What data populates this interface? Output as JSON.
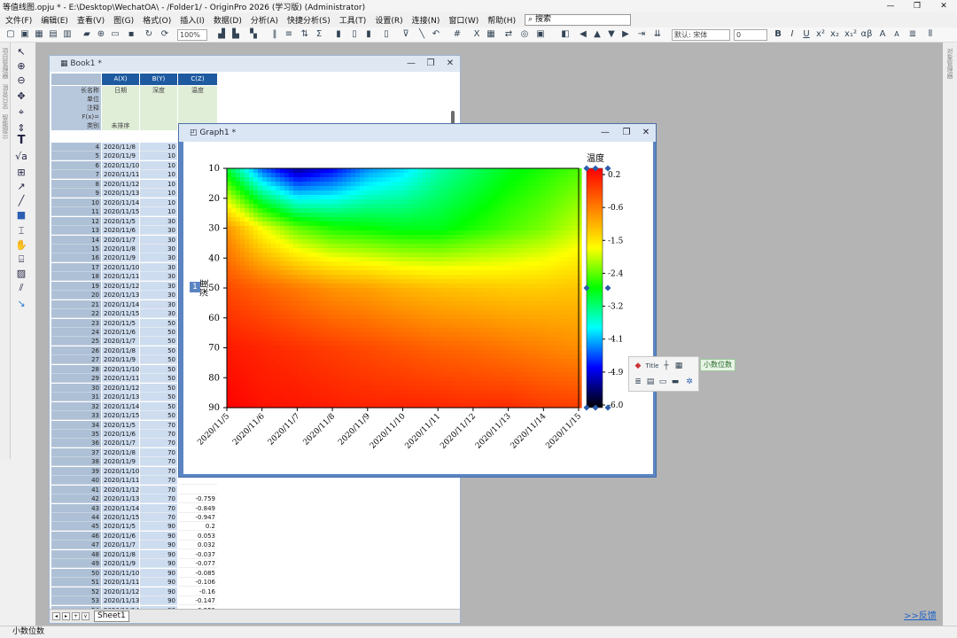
{
  "app": {
    "title": "等值线图.opju * - E:\\Desktop\\WechatOA\\ - /Folder1/ - OriginPro 2026 (学习版) (Administrator)",
    "window_controls": [
      "—",
      "❐",
      "✕"
    ]
  },
  "menu": {
    "items": [
      "文件(F)",
      "编辑(E)",
      "查看(V)",
      "图(G)",
      "格式(O)",
      "插入(I)",
      "数据(D)",
      "分析(A)",
      "快捷分析(S)",
      "工具(T)",
      "设置(R)",
      "连接(N)",
      "窗口(W)",
      "帮助(H)"
    ],
    "search_placeholder": "搜索"
  },
  "toolbar": {
    "zoom": "100%",
    "font_name": "默认: 宋体",
    "font_size": "0",
    "format_buttons": [
      "B",
      "I",
      "U",
      "x²",
      "x₂",
      "x₁²",
      "αβ",
      "A",
      "A"
    ],
    "icons": [
      "new-project-icon",
      "open-icon",
      "save-icon",
      "graph-icon",
      "arrow-left-icon",
      "arrow-up-icon",
      "arrow-down-icon",
      "arrow-right-icon"
    ]
  },
  "left_tools": {
    "icons": [
      "pointer-icon",
      "zoom-in-icon",
      "zoom-out-icon",
      "pan-icon",
      "crosshair-icon",
      "scale-icon",
      "text-icon",
      "equation-icon",
      "box-icon",
      "arrow-icon",
      "line-icon",
      "rectangle-icon",
      "marker-icon",
      "hand-icon",
      "data-reader-icon",
      "region-icon",
      "curve-icon",
      "fit-icon"
    ],
    "text_tool": "T",
    "sqrt_tool": "√a"
  },
  "rails": {
    "left_labels": [
      "项目管理器",
      "消息日志",
      "智能提示"
    ],
    "right_labels": [
      "对象管理器"
    ]
  },
  "book": {
    "title": "Book1 *",
    "columns": [
      "A(X)",
      "B(Y)",
      "C(Z)"
    ],
    "label_rows": [
      {
        "name": "长名称",
        "a": "日期",
        "b": "深度",
        "c": "温度"
      },
      {
        "name": "单位",
        "a": "",
        "b": "",
        "c": ""
      },
      {
        "name": "注释",
        "a": "",
        "b": "",
        "c": ""
      },
      {
        "name": "F(x)=",
        "a": "",
        "b": "",
        "c": ""
      },
      {
        "name": "类别",
        "a": "未排序",
        "b": "",
        "c": ""
      }
    ],
    "rows": [
      {
        "n": "4",
        "date": "2020/11/8",
        "depth": "10",
        "temp": ""
      },
      {
        "n": "5",
        "date": "2020/11/9",
        "depth": "10",
        "temp": ""
      },
      {
        "n": "6",
        "date": "2020/11/10",
        "depth": "10",
        "temp": ""
      },
      {
        "n": "7",
        "date": "2020/11/11",
        "depth": "10",
        "temp": ""
      },
      {
        "n": "8",
        "date": "2020/11/12",
        "depth": "10",
        "temp": ""
      },
      {
        "n": "9",
        "date": "2020/11/13",
        "depth": "10",
        "temp": ""
      },
      {
        "n": "10",
        "date": "2020/11/14",
        "depth": "10",
        "temp": ""
      },
      {
        "n": "11",
        "date": "2020/11/15",
        "depth": "10",
        "temp": ""
      },
      {
        "n": "12",
        "date": "2020/11/5",
        "depth": "30",
        "temp": ""
      },
      {
        "n": "13",
        "date": "2020/11/6",
        "depth": "30",
        "temp": ""
      },
      {
        "n": "14",
        "date": "2020/11/7",
        "depth": "30",
        "temp": ""
      },
      {
        "n": "15",
        "date": "2020/11/8",
        "depth": "30",
        "temp": ""
      },
      {
        "n": "16",
        "date": "2020/11/9",
        "depth": "30",
        "temp": ""
      },
      {
        "n": "17",
        "date": "2020/11/10",
        "depth": "30",
        "temp": ""
      },
      {
        "n": "18",
        "date": "2020/11/11",
        "depth": "30",
        "temp": ""
      },
      {
        "n": "19",
        "date": "2020/11/12",
        "depth": "30",
        "temp": ""
      },
      {
        "n": "20",
        "date": "2020/11/13",
        "depth": "30",
        "temp": ""
      },
      {
        "n": "21",
        "date": "2020/11/14",
        "depth": "30",
        "temp": ""
      },
      {
        "n": "22",
        "date": "2020/11/15",
        "depth": "30",
        "temp": ""
      },
      {
        "n": "23",
        "date": "2020/11/5",
        "depth": "50",
        "temp": ""
      },
      {
        "n": "24",
        "date": "2020/11/6",
        "depth": "50",
        "temp": ""
      },
      {
        "n": "25",
        "date": "2020/11/7",
        "depth": "50",
        "temp": ""
      },
      {
        "n": "26",
        "date": "2020/11/8",
        "depth": "50",
        "temp": ""
      },
      {
        "n": "27",
        "date": "2020/11/9",
        "depth": "50",
        "temp": ""
      },
      {
        "n": "28",
        "date": "2020/11/10",
        "depth": "50",
        "temp": ""
      },
      {
        "n": "29",
        "date": "2020/11/11",
        "depth": "50",
        "temp": ""
      },
      {
        "n": "30",
        "date": "2020/11/12",
        "depth": "50",
        "temp": ""
      },
      {
        "n": "31",
        "date": "2020/11/13",
        "depth": "50",
        "temp": ""
      },
      {
        "n": "32",
        "date": "2020/11/14",
        "depth": "50",
        "temp": ""
      },
      {
        "n": "33",
        "date": "2020/11/15",
        "depth": "50",
        "temp": ""
      },
      {
        "n": "34",
        "date": "2020/11/5",
        "depth": "70",
        "temp": ""
      },
      {
        "n": "35",
        "date": "2020/11/6",
        "depth": "70",
        "temp": ""
      },
      {
        "n": "36",
        "date": "2020/11/7",
        "depth": "70",
        "temp": ""
      },
      {
        "n": "37",
        "date": "2020/11/8",
        "depth": "70",
        "temp": ""
      },
      {
        "n": "38",
        "date": "2020/11/9",
        "depth": "70",
        "temp": ""
      },
      {
        "n": "39",
        "date": "2020/11/10",
        "depth": "70",
        "temp": ""
      },
      {
        "n": "40",
        "date": "2020/11/11",
        "depth": "70",
        "temp": ""
      },
      {
        "n": "41",
        "date": "2020/11/12",
        "depth": "70",
        "temp": ""
      },
      {
        "n": "42",
        "date": "2020/11/13",
        "depth": "70",
        "temp": "-0.759"
      },
      {
        "n": "43",
        "date": "2020/11/14",
        "depth": "70",
        "temp": "-0.849"
      },
      {
        "n": "44",
        "date": "2020/11/15",
        "depth": "70",
        "temp": "-0.947"
      },
      {
        "n": "45",
        "date": "2020/11/5",
        "depth": "90",
        "temp": "0.2"
      },
      {
        "n": "46",
        "date": "2020/11/6",
        "depth": "90",
        "temp": "0.053"
      },
      {
        "n": "47",
        "date": "2020/11/7",
        "depth": "90",
        "temp": "0.032"
      },
      {
        "n": "48",
        "date": "2020/11/8",
        "depth": "90",
        "temp": "-0.037"
      },
      {
        "n": "49",
        "date": "2020/11/9",
        "depth": "90",
        "temp": "-0.077"
      },
      {
        "n": "50",
        "date": "2020/11/10",
        "depth": "90",
        "temp": "-0.085"
      },
      {
        "n": "51",
        "date": "2020/11/11",
        "depth": "90",
        "temp": "-0.106"
      },
      {
        "n": "52",
        "date": "2020/11/12",
        "depth": "90",
        "temp": "-0.16"
      },
      {
        "n": "53",
        "date": "2020/11/13",
        "depth": "90",
        "temp": "-0.147"
      },
      {
        "n": "54",
        "date": "2020/11/14",
        "depth": "90",
        "temp": "-0.259"
      },
      {
        "n": "55",
        "date": "2020/11/15",
        "depth": "90",
        "temp": "-0.299"
      }
    ],
    "sheet_tab": "Sheet1",
    "sheet_nav": [
      "◂",
      "▸",
      "+",
      "∨"
    ]
  },
  "graph": {
    "title": "Graph1 *",
    "layer_badge": "1"
  },
  "chart_data": {
    "type": "heatmap",
    "title": "",
    "xlabel": "",
    "ylabel": "深度",
    "x_categories": [
      "2020/11/5",
      "2020/11/6",
      "2020/11/7",
      "2020/11/8",
      "2020/11/9",
      "2020/11/10",
      "2020/11/11",
      "2020/11/12",
      "2020/11/13",
      "2020/11/14",
      "2020/11/15"
    ],
    "y_ticks": [
      10,
      20,
      30,
      40,
      50,
      60,
      70,
      80,
      90
    ],
    "ylim": [
      10,
      90
    ],
    "y_reversed": true,
    "grid": false,
    "colorbar": {
      "title": "温度",
      "ticks": [
        "0.2",
        "-0.6",
        "-1.5",
        "-2.4",
        "-3.2",
        "-4.1",
        "-4.9",
        "-6.0"
      ],
      "range": [
        -6.0,
        0.2
      ],
      "colors": [
        "#ff0000",
        "#ff8000",
        "#ffff00",
        "#00ff00",
        "#00ffff",
        "#0000ff",
        "#000000"
      ]
    },
    "depths": [
      10,
      30,
      50,
      70,
      90
    ],
    "z": [
      [
        -3.1,
        -4.6,
        -5.4,
        -5.0,
        -4.4,
        -4.1,
        -3.6,
        -3.3,
        -3.0,
        -2.8,
        -2.6
      ],
      [
        -1.0,
        -1.9,
        -2.5,
        -2.8,
        -2.9,
        -3.0,
        -3.0,
        -2.8,
        -2.6,
        -2.4,
        -2.1
      ],
      [
        -0.4,
        -0.6,
        -0.8,
        -1.0,
        -1.1,
        -1.25,
        -1.35,
        -1.4,
        -1.45,
        -1.45,
        -1.4
      ],
      [
        0.0,
        -0.1,
        -0.2,
        -0.3,
        -0.4,
        -0.5,
        -0.6,
        -0.66,
        -0.759,
        -0.849,
        -0.947
      ],
      [
        0.2,
        0.053,
        0.032,
        -0.037,
        -0.077,
        -0.085,
        -0.106,
        -0.16,
        -0.147,
        -0.259,
        -0.299
      ]
    ]
  },
  "minitoolbar": {
    "icons": [
      "color-icon",
      "title-icon",
      "axis-icon",
      "grid-icon",
      "tick-icon",
      "layout-icon",
      "ruler-icon",
      "line-icon",
      "settings-icon"
    ],
    "title_label": "Title",
    "tooltip": "小数位数"
  },
  "feedback_link": ">>反馈",
  "status": {
    "text": "小数位数"
  }
}
